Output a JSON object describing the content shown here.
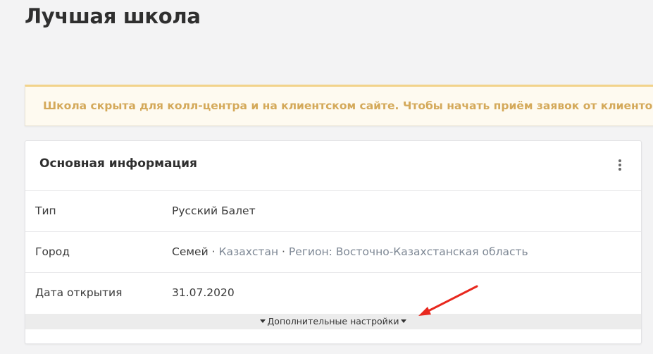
{
  "page": {
    "title": "Лучшая школа"
  },
  "warning": {
    "text": "Школа скрыта для колл-центра и на клиентском сайте. Чтобы начать приём заявок от клиентов через колл-центр"
  },
  "card": {
    "title": "Основная информация",
    "menu_icon": "kebab-menu-icon",
    "rows": [
      {
        "label": "Тип",
        "value": "Русский Балет"
      },
      {
        "label": "Город",
        "city": "Семей",
        "separator": "·",
        "country": "Казахстан",
        "region": "Регион: Восточно-Казахстанская область"
      },
      {
        "label": "Дата открытия",
        "value": "31.07.2020"
      }
    ],
    "more_settings_label": "Дополнительные настройки"
  },
  "colors": {
    "warning_text": "#d4a95a",
    "warning_border": "#f2d38a",
    "muted_link": "#7d8794",
    "annotation_arrow": "#e8281e"
  }
}
